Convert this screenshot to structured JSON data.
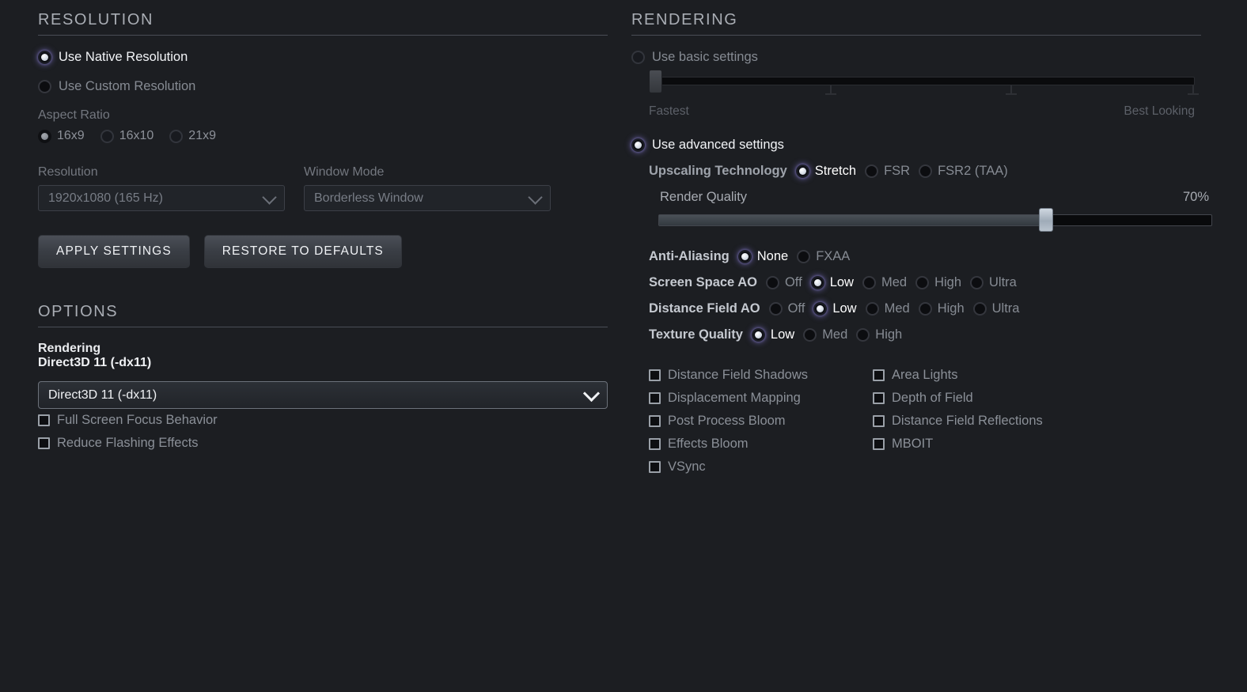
{
  "resolution": {
    "heading": "RESOLUTION",
    "mode_options": [
      {
        "label": "Use Native Resolution",
        "selected": true
      },
      {
        "label": "Use Custom Resolution",
        "selected": false
      }
    ],
    "aspect_ratio_label": "Aspect Ratio",
    "aspect_options": [
      {
        "label": "16x9",
        "selected": true
      },
      {
        "label": "16x10",
        "selected": false
      },
      {
        "label": "21x9",
        "selected": false
      }
    ],
    "resolution_field_label": "Resolution",
    "resolution_value": "1920x1080 (165 Hz)",
    "window_mode_label": "Window Mode",
    "window_mode_value": "Borderless Window",
    "apply_button": "APPLY SETTINGS",
    "restore_button": "RESTORE TO DEFAULTS"
  },
  "options": {
    "heading": "OPTIONS",
    "rendering_label": "Rendering",
    "rendering_value": "Direct3D 11 (-dx11)",
    "rendering_select_value": "Direct3D 11 (-dx11)",
    "checkboxes": [
      {
        "label": "Full Screen Focus Behavior",
        "checked": false
      },
      {
        "label": "Reduce Flashing Effects",
        "checked": false
      }
    ]
  },
  "rendering": {
    "heading": "RENDERING",
    "basic_radio": {
      "label": "Use basic settings",
      "selected": false
    },
    "basic_slider": {
      "min_label": "Fastest",
      "max_label": "Best Looking",
      "value_percent": 0,
      "tick_percents": [
        33,
        66,
        100
      ]
    },
    "advanced_radio": {
      "label": "Use advanced settings",
      "selected": true
    },
    "upscaling": {
      "label": "Upscaling Technology",
      "options": [
        {
          "label": "Stretch",
          "selected": true
        },
        {
          "label": "FSR",
          "selected": false
        },
        {
          "label": "FSR2 (TAA)",
          "selected": false
        }
      ]
    },
    "render_quality": {
      "label": "Render Quality",
      "value_label": "70%",
      "value_percent": 70
    },
    "quality_rows": [
      {
        "label": "Anti-Aliasing",
        "options": [
          {
            "label": "None",
            "selected": true
          },
          {
            "label": "FXAA",
            "selected": false
          }
        ]
      },
      {
        "label": "Screen Space AO",
        "options": [
          {
            "label": "Off",
            "selected": false
          },
          {
            "label": "Low",
            "selected": true
          },
          {
            "label": "Med",
            "selected": false
          },
          {
            "label": "High",
            "selected": false
          },
          {
            "label": "Ultra",
            "selected": false
          }
        ]
      },
      {
        "label": "Distance Field AO",
        "options": [
          {
            "label": "Off",
            "selected": false
          },
          {
            "label": "Low",
            "selected": true
          },
          {
            "label": "Med",
            "selected": false
          },
          {
            "label": "High",
            "selected": false
          },
          {
            "label": "Ultra",
            "selected": false
          }
        ]
      },
      {
        "label": "Texture Quality",
        "options": [
          {
            "label": "Low",
            "selected": true
          },
          {
            "label": "Med",
            "selected": false
          },
          {
            "label": "High",
            "selected": false
          }
        ]
      }
    ],
    "toggle_column_left": [
      {
        "label": "Distance Field Shadows",
        "checked": false
      },
      {
        "label": "Displacement Mapping",
        "checked": false
      },
      {
        "label": "Post Process Bloom",
        "checked": false
      },
      {
        "label": "Effects Bloom",
        "checked": false
      },
      {
        "label": "VSync",
        "checked": false
      }
    ],
    "toggle_column_right": [
      {
        "label": "Area Lights",
        "checked": false
      },
      {
        "label": "Depth of Field",
        "checked": false
      },
      {
        "label": "Distance Field Reflections",
        "checked": false
      },
      {
        "label": "MBOIT",
        "checked": false
      }
    ]
  },
  "colors": {
    "background": "#1c1e22",
    "selected_glow": "#786eBE",
    "text_bright": "#f2f4f7",
    "text_dim": "#868b93",
    "rule": "#4a4e56"
  }
}
